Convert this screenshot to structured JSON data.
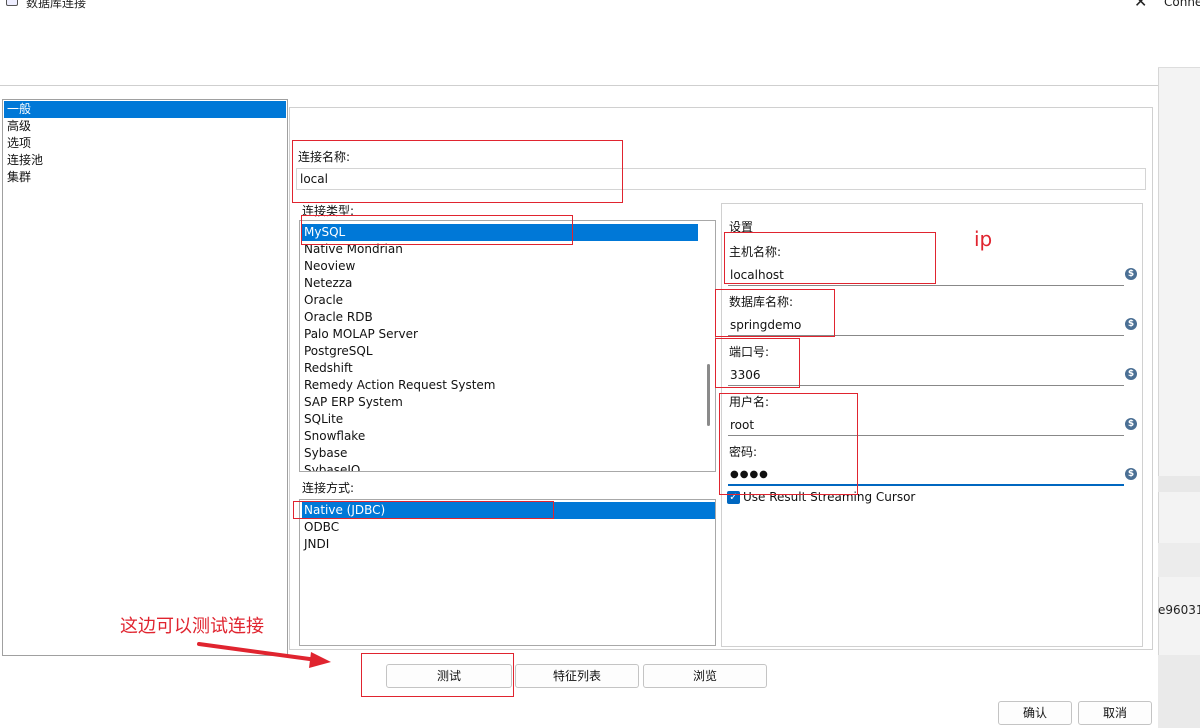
{
  "window": {
    "title": "数据库连接",
    "close_glyph": "✕",
    "side_conn_text": "Conne",
    "side_hash_text": "e96031"
  },
  "nav": {
    "items": [
      "一般",
      "高级",
      "选项",
      "连接池",
      "集群"
    ],
    "selected_index": 0
  },
  "connection": {
    "name_label": "连接名称:",
    "name_value": "local",
    "type_label": "连接类型:",
    "types": [
      "MySQL",
      "Native Mondrian",
      "Neoview",
      "Netezza",
      "Oracle",
      "Oracle RDB",
      "Palo MOLAP Server",
      "PostgreSQL",
      "Redshift",
      "Remedy Action Request System",
      "SAP ERP System",
      "SQLite",
      "Snowflake",
      "Sybase",
      "SybaseIQ"
    ],
    "selected_type": "MySQL",
    "method_label": "连接方式:",
    "methods": [
      "Native (JDBC)",
      "ODBC",
      "JNDI"
    ],
    "selected_method": "Native (JDBC)"
  },
  "settings": {
    "title": "设置",
    "host_label": "主机名称:",
    "host_value": "localhost",
    "db_label": "数据库名称:",
    "db_value": "springdemo",
    "port_label": "端口号:",
    "port_value": "3306",
    "user_label": "用户名:",
    "user_value": "root",
    "password_label": "密码:",
    "password_value": "●●●●",
    "streaming_label": "Use Result Streaming Cursor",
    "streaming_checked": true,
    "var_icon_glyph": "$"
  },
  "buttons": {
    "test": "测试",
    "features": "特征列表",
    "browse": "浏览",
    "ok": "确认",
    "cancel": "取消"
  },
  "annotations": {
    "ip_note": "ip",
    "test_note": "这边可以测试连接",
    "color": "#e0242f"
  },
  "colors": {
    "selection": "#0078d7",
    "accent": "#0067c0"
  }
}
